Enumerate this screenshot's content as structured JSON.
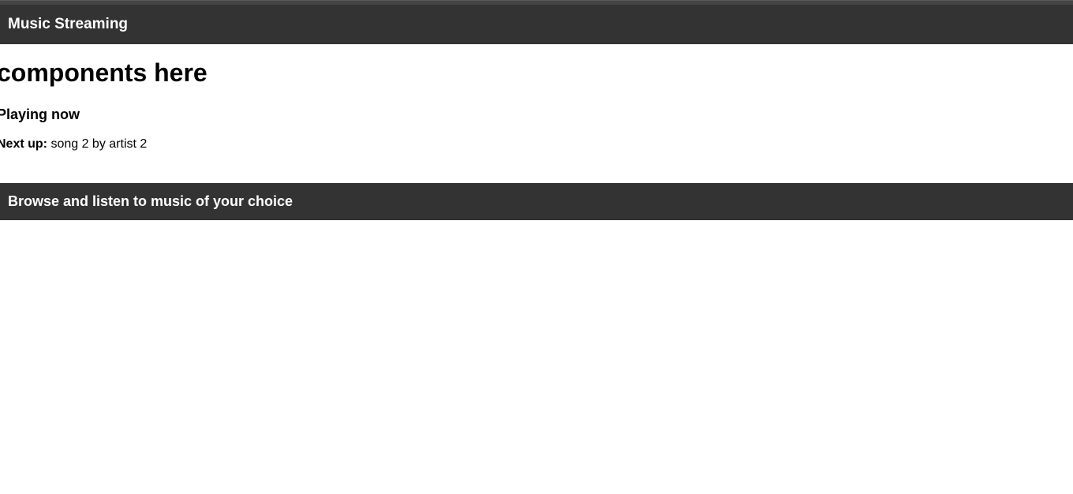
{
  "header": {
    "brand": "Music Streaming"
  },
  "main": {
    "heading": "components here",
    "playing_now_label": "Playing now",
    "next_up_label": "Next up:",
    "next_up_value": " song 2 by artist 2"
  },
  "footer": {
    "text": "Browse and listen to music of your choice"
  }
}
